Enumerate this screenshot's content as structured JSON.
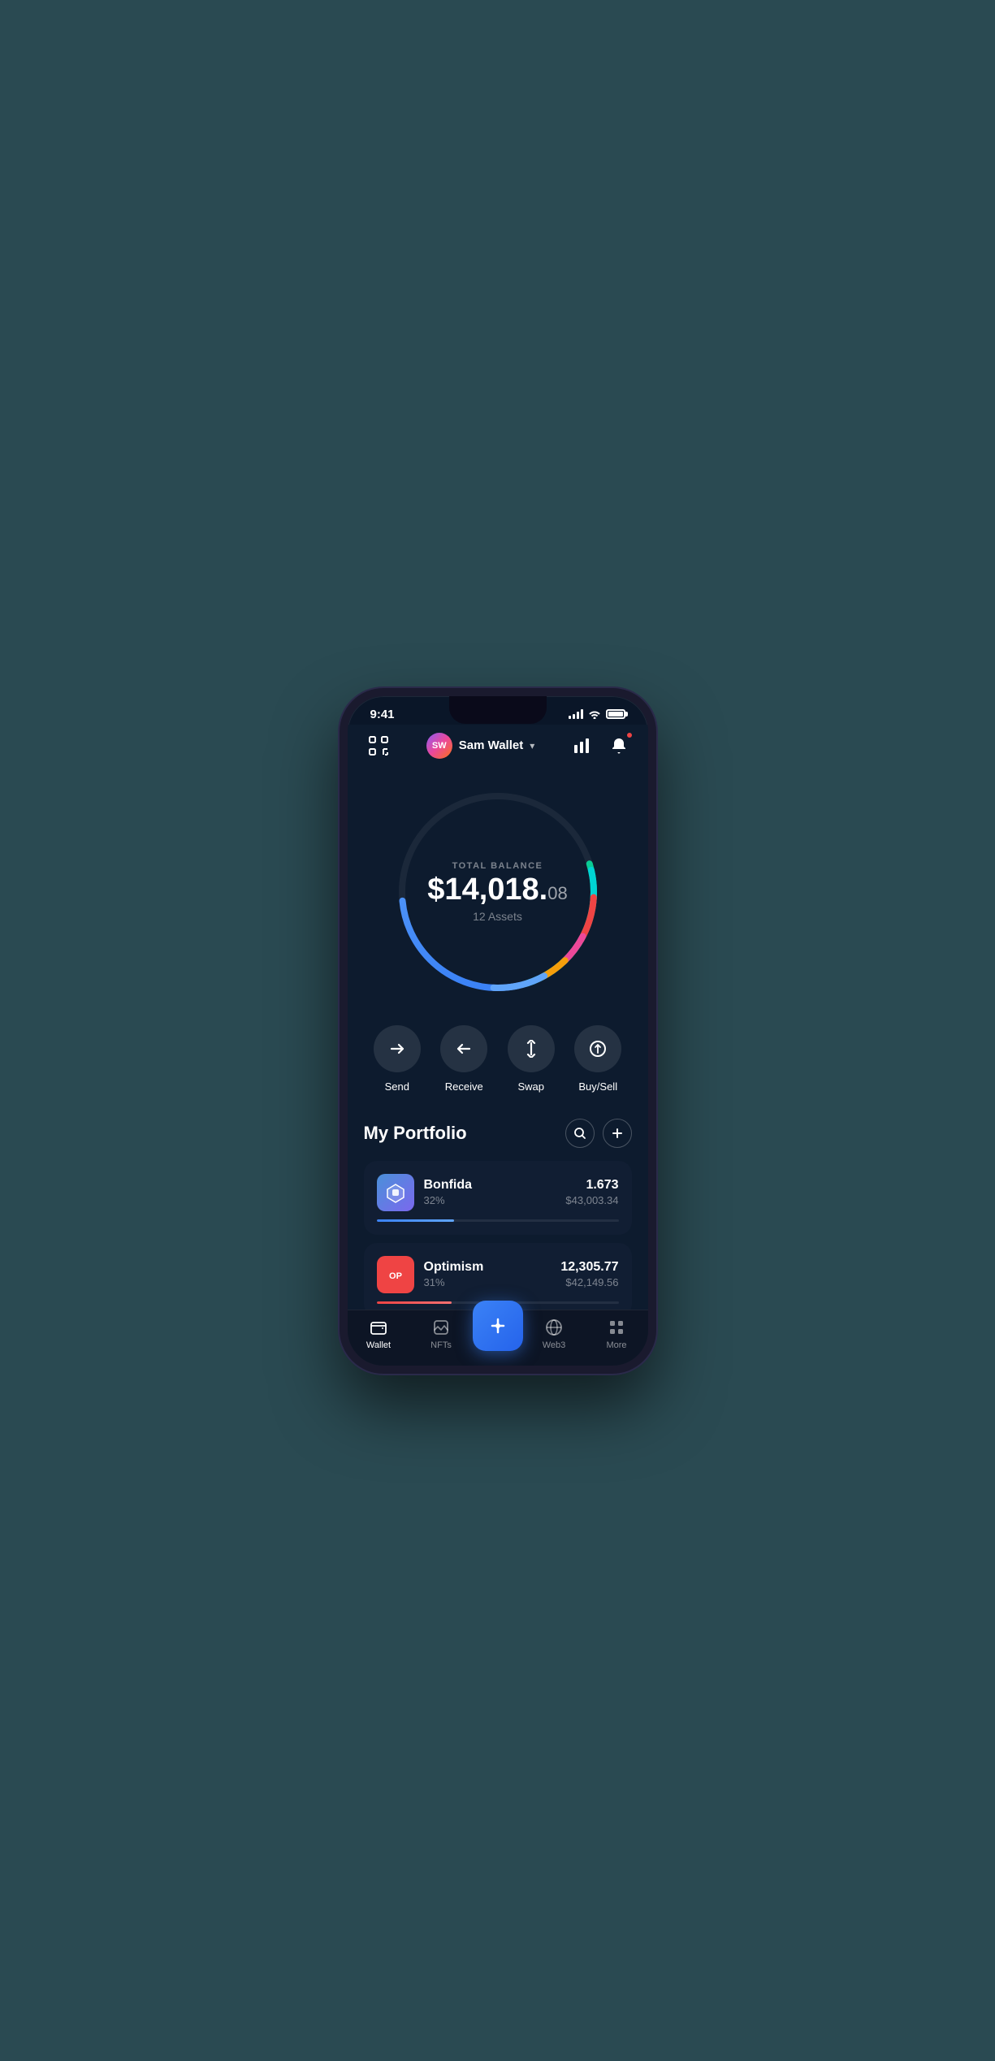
{
  "statusBar": {
    "time": "9:41"
  },
  "header": {
    "walletName": "Sam Wallet",
    "avatarInitials": "SW",
    "scanLabel": "scan",
    "notificationsLabel": "notifications",
    "analyticsLabel": "analytics"
  },
  "balance": {
    "label": "TOTAL BALANCE",
    "whole": "$14,018.",
    "cents": "08",
    "assetsCount": "12 Assets"
  },
  "actions": [
    {
      "id": "send",
      "label": "Send"
    },
    {
      "id": "receive",
      "label": "Receive"
    },
    {
      "id": "swap",
      "label": "Swap"
    },
    {
      "id": "buysell",
      "label": "Buy/Sell"
    }
  ],
  "portfolio": {
    "title": "My Portfolio",
    "searchLabel": "search",
    "addLabel": "add",
    "assets": [
      {
        "name": "Bonfida",
        "percent": "32%",
        "amount": "1.673",
        "value": "$43,003.34",
        "progressWidth": 32,
        "progressColor": "#3b82f6",
        "iconType": "bonfida"
      },
      {
        "name": "Optimism",
        "percent": "31%",
        "amount": "12,305.77",
        "value": "$42,149.56",
        "progressWidth": 31,
        "progressColor": "#ef4444",
        "iconType": "optimism"
      }
    ]
  },
  "bottomNav": {
    "items": [
      {
        "id": "wallet",
        "label": "Wallet",
        "active": true
      },
      {
        "id": "nfts",
        "label": "NFTs",
        "active": false
      },
      {
        "id": "center",
        "label": "",
        "active": false
      },
      {
        "id": "web3",
        "label": "Web3",
        "active": false
      },
      {
        "id": "more",
        "label": "More",
        "active": false
      }
    ]
  }
}
